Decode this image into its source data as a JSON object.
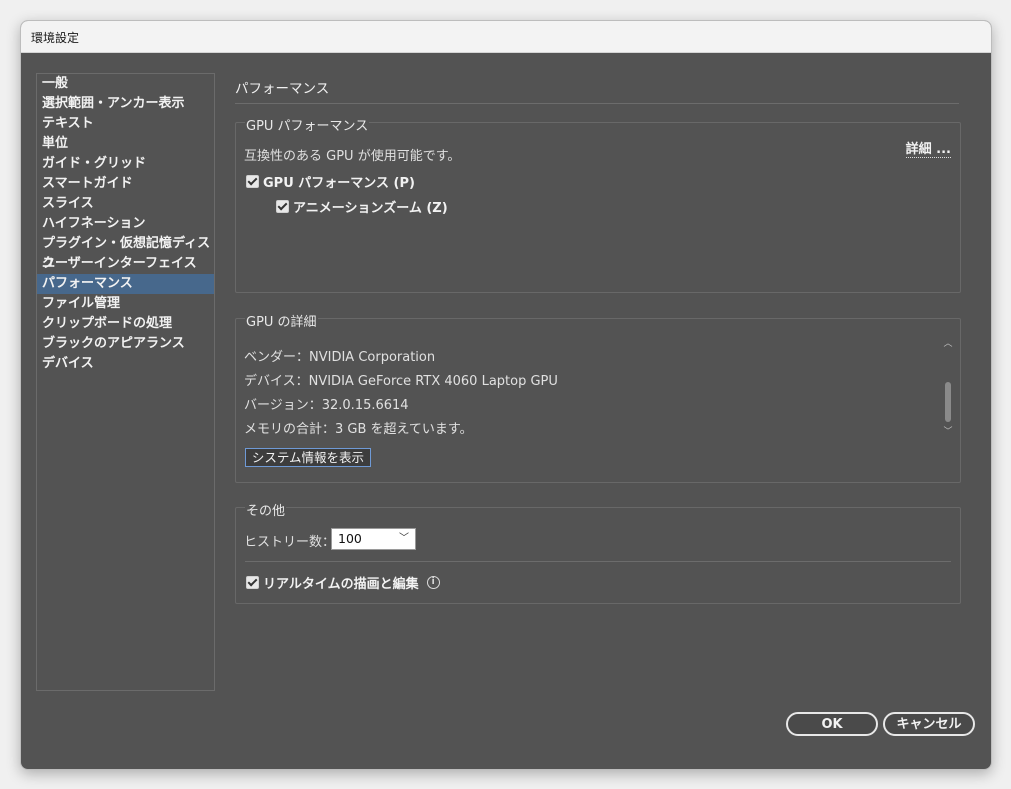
{
  "window": {
    "title": "環境設定"
  },
  "sidebar": {
    "selected_index": 10,
    "items": [
      "一般",
      "選択範囲・アンカー表示",
      "テキスト",
      "単位",
      "ガイド・グリッド",
      "スマートガイド",
      "スライス",
      "ハイフネーション",
      "プラグイン・仮想記憶ディスク",
      "ユーザーインターフェイス",
      "パフォーマンス",
      "ファイル管理",
      "クリップボードの処理",
      "ブラックのアピアランス",
      "デバイス"
    ]
  },
  "main": {
    "section_title": "パフォーマンス",
    "gpu_performance": {
      "group_label": "GPU パフォーマンス",
      "compat_text": "互換性のある GPU が使用可能です。",
      "details_link": "詳細 ...",
      "gpu_checkbox_label": "GPU パフォーマンス (P)",
      "gpu_checked": true,
      "animation_zoom_label": "アニメーションズーム (Z)",
      "animation_zoom_checked": true
    },
    "gpu_details": {
      "group_label": "GPU の詳細",
      "lines": [
        "ベンダー：NVIDIA Corporation",
        "デバイス：NVIDIA GeForce RTX 4060 Laptop GPU",
        "バージョン：32.0.15.6614",
        "メモリの合計：3 GB を超えています。"
      ],
      "system_info_button": "システム情報を表示"
    },
    "other": {
      "group_label": "その他",
      "history_label": "ヒストリー数：",
      "history_value": "100",
      "realtime_label": "リアルタイムの描画と編集",
      "realtime_checked": true
    }
  },
  "footer": {
    "ok_label": "OK",
    "cancel_label": "キャンセル"
  }
}
